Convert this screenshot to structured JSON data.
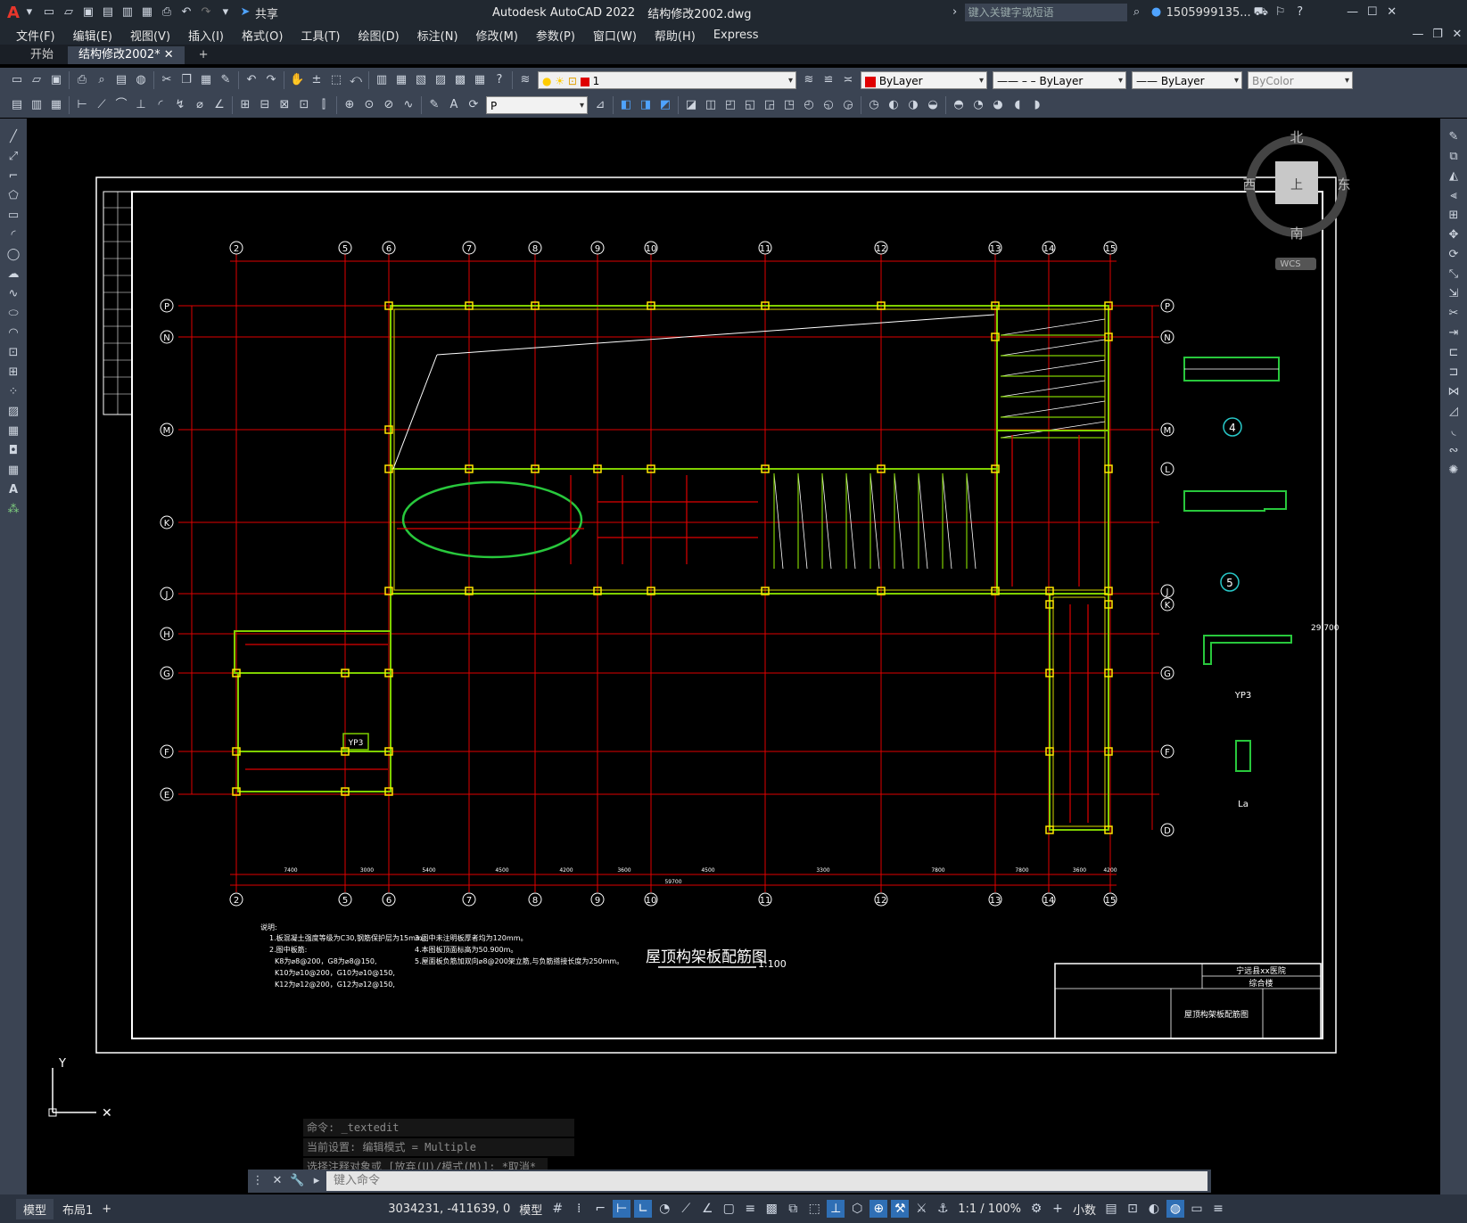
{
  "title_bar": {
    "app_title": "Autodesk AutoCAD 2022",
    "file_title": "结构修改2002.dwg",
    "share_label": "共享",
    "search_placeholder": "键入关键字或短语",
    "user_id": "1505999135..."
  },
  "menu": [
    "文件(F)",
    "编辑(E)",
    "视图(V)",
    "插入(I)",
    "格式(O)",
    "工具(T)",
    "绘图(D)",
    "标注(N)",
    "修改(M)",
    "参数(P)",
    "窗口(W)",
    "帮助(H)",
    "Express"
  ],
  "tabs": [
    {
      "label": "开始",
      "active": false
    },
    {
      "label": "结构修改2002*",
      "active": true
    }
  ],
  "properties": {
    "layer": "1",
    "color": "ByLayer",
    "linetype": "ByLayer",
    "lineweight": "ByLayer",
    "plotstyle": "ByColor",
    "dimstyle_value": "P"
  },
  "viewcube": {
    "north": "北",
    "south": "南",
    "east": "东",
    "west": "西",
    "top_face": "上",
    "wcs": "WCS"
  },
  "ucs": {
    "y": "Y"
  },
  "drawing": {
    "title": "屋顶构架板配筋图",
    "scale": "1:100",
    "top_grid_labels": [
      "2",
      "5",
      "6",
      "7",
      "8",
      "9",
      "10",
      "11",
      "12",
      "13",
      "14",
      "15"
    ],
    "left_grid_labels": [
      "P",
      "N",
      "M",
      "K",
      "J",
      "H",
      "G",
      "F",
      "E"
    ],
    "right_grid_labels": [
      "P",
      "N",
      "M",
      "L",
      "J",
      "K",
      "G",
      "F",
      "D"
    ],
    "bottom_dims": [
      "7400",
      "3000",
      "5400",
      "4500",
      "4200",
      "3600",
      "4500",
      "3300",
      "7800",
      "7800",
      "3600",
      "4200"
    ],
    "total_dim": "59700",
    "section_labels": [
      "4",
      "5",
      "YP3",
      "La"
    ],
    "notes_title": "说明:",
    "notes_left": [
      "1.板混凝土强度等级为C30,钢筋保护层为15mm。",
      "2.图中板筋:",
      "K8为⌀8@200，G8为⌀8@150,",
      "K10为⌀10@200，G10为⌀10@150,",
      "K12为⌀12@200，G12为⌀12@150,"
    ],
    "notes_right": [
      "3.图中未注明板厚者均为120mm。",
      "4.本图板顶面标高为50.900m。",
      "5.屋面板负筋加双向⌀8@200架立筋,与负筋搭接长度为250mm。"
    ],
    "title_block": {
      "project": "宁远县xx医院",
      "building": "综合楼",
      "drawing_name": "屋顶构架板配筋图"
    },
    "yp3_label": "YP3",
    "level": "29.700"
  },
  "command_history": [
    "命令: _textedit",
    "当前设置: 编辑模式 = Multiple",
    "选择注释对象或 [放弃(U)/模式(M)]: *取消*"
  ],
  "command_placeholder": "键入命令",
  "layout_tabs": [
    "模型",
    "布局1"
  ],
  "status": {
    "coords": "3034231, -411639, 0",
    "mode": "模型",
    "scale": "1:1 / 100%",
    "units": "小数"
  }
}
